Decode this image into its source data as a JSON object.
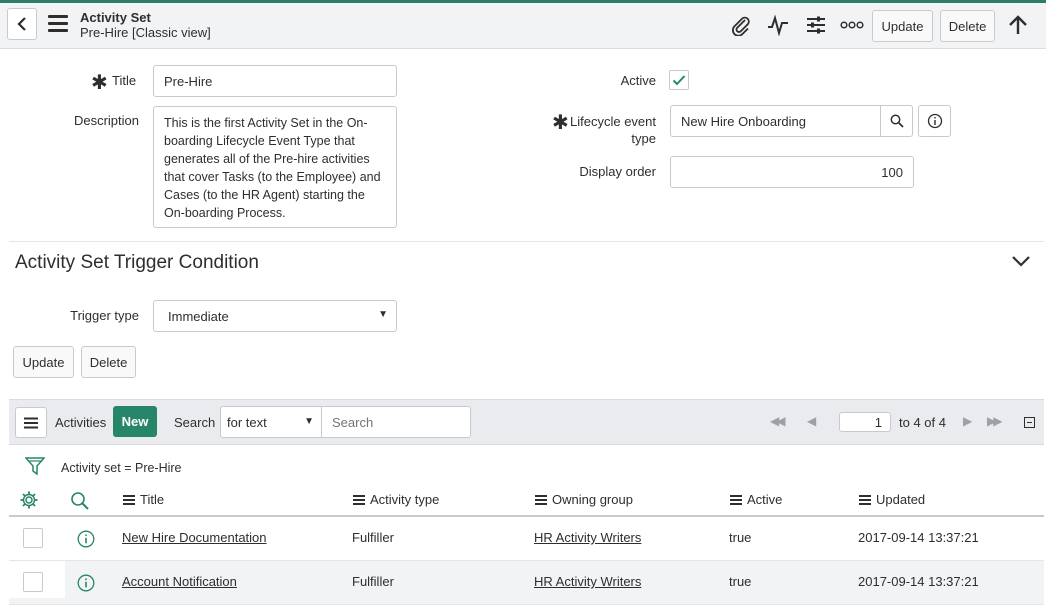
{
  "header": {
    "title": "Activity Set",
    "subtitle": "Pre-Hire [Classic view]",
    "update_label": "Update",
    "delete_label": "Delete"
  },
  "form": {
    "title_label": "Title",
    "title_value": "Pre-Hire",
    "description_label": "Description",
    "description_value": "This is the first Activity Set in the On-boarding Lifecycle Event Type that generates all of the Pre-hire activities that cover Tasks (to the Employee) and Cases (to the HR Agent) starting the On-boarding Process.",
    "active_label": "Active",
    "active_checked": true,
    "lifecycle_label_1": "Lifecycle event",
    "lifecycle_label_2": "type",
    "lifecycle_value": "New Hire Onboarding",
    "display_order_label": "Display order",
    "display_order_value": "100"
  },
  "section": {
    "title": "Activity Set Trigger Condition",
    "trigger_label": "Trigger type",
    "trigger_value": "Immediate",
    "update_label": "Update",
    "delete_label": "Delete"
  },
  "list": {
    "title": "Activities",
    "new_label": "New",
    "search_label": "Search",
    "search_field": "for text",
    "search_placeholder": "Search",
    "page_value": "1",
    "page_range": "to 4 of 4",
    "filter_text": "Activity set = Pre-Hire",
    "columns": [
      "Title",
      "Activity type",
      "Owning group",
      "Active",
      "Updated"
    ],
    "rows": [
      {
        "title": "New Hire Documentation",
        "type": "Fulfiller",
        "group": "HR Activity Writers",
        "active": "true",
        "updated": "2017-09-14 13:37:21"
      },
      {
        "title": "Account Notification",
        "type": "Fulfiller",
        "group": "HR Activity Writers",
        "active": "true",
        "updated": "2017-09-14 13:37:21"
      }
    ]
  },
  "colors": {
    "accent": "#278669",
    "header_bg": "#f2f3f5"
  }
}
